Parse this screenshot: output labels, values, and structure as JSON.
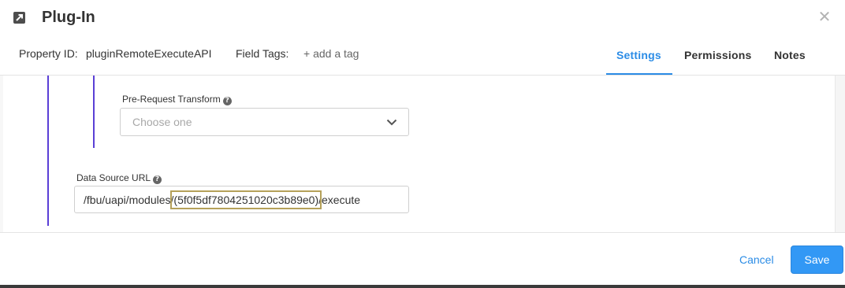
{
  "header": {
    "title": "Plug-In",
    "title_icon": "expand-arrow-icon",
    "close_icon": "close-icon",
    "close_glyph": "✕",
    "property_id_label": "Property ID:",
    "property_id_value": "pluginRemoteExecuteAPI",
    "field_tags_label": "Field Tags:",
    "add_tag_label": "+ add a tag"
  },
  "tabs": [
    {
      "label": "Settings",
      "active": true
    },
    {
      "label": "Permissions",
      "active": false
    },
    {
      "label": "Notes",
      "active": false
    }
  ],
  "form": {
    "pre_request_transform": {
      "label": "Pre-Request Transform",
      "placeholder": "Choose one",
      "help_glyph": "?"
    },
    "data_source_url": {
      "label": "Data Source URL",
      "help_glyph": "?",
      "value_prefix": "/fbu/uapi/modules/",
      "value_highlight": "(5f0f5df7804251020c3b89e0)",
      "value_suffix": "/execute"
    }
  },
  "footer": {
    "cancel_label": "Cancel",
    "save_label": "Save"
  },
  "colors": {
    "accent": "#2b8ce6",
    "save_button": "#3298f5",
    "nesting_line": "#5a3fd6",
    "highlight_outline": "#b5a15a"
  }
}
